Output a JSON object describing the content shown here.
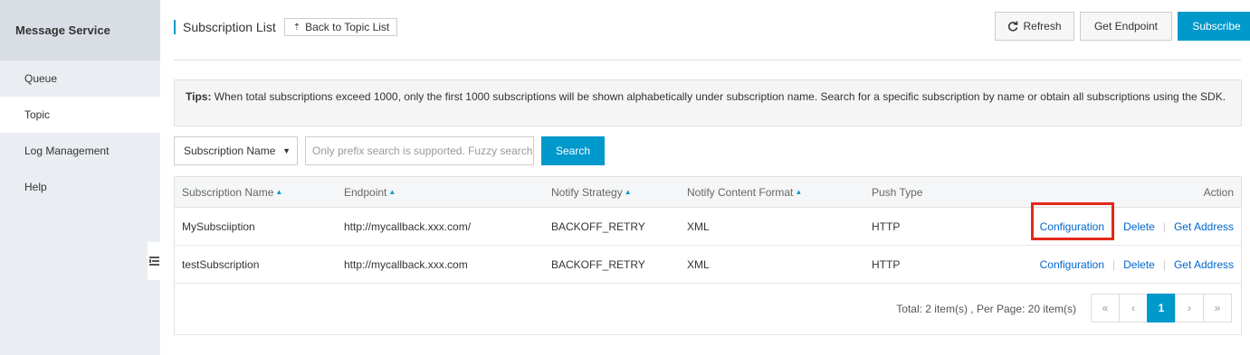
{
  "sidebar": {
    "title": "Message Service",
    "items": [
      {
        "label": "Queue"
      },
      {
        "label": "Topic"
      },
      {
        "label": "Log Management"
      },
      {
        "label": "Help"
      }
    ]
  },
  "header": {
    "title": "Subscription List",
    "back_label": "Back to Topic List",
    "refresh_label": "Refresh",
    "get_endpoint_label": "Get Endpoint",
    "subscribe_label": "Subscribe"
  },
  "tips": {
    "prefix": "Tips:",
    "text": " When total subscriptions exceed 1000, only the first 1000 subscriptions will be shown alphabetically under subscription name. Search for a specific subscription by name or obtain all subscriptions using the SDK."
  },
  "filter": {
    "select_value": "Subscription Name",
    "search_placeholder": "Only prefix search is supported. Fuzzy search is not supported.",
    "search_label": "Search"
  },
  "table": {
    "columns": {
      "name": "Subscription Name",
      "endpoint": "Endpoint",
      "strategy": "Notify Strategy",
      "format": "Notify Content Format",
      "push": "Push Type",
      "action": "Action"
    },
    "rows": [
      {
        "name": "MySubsciiption",
        "endpoint": "http://mycallback.xxx.com/",
        "strategy": "BACKOFF_RETRY",
        "format": "XML",
        "push": "HTTP"
      },
      {
        "name": "testSubscription",
        "endpoint": "http://mycallback.xxx.com",
        "strategy": "BACKOFF_RETRY",
        "format": "XML",
        "push": "HTTP"
      }
    ],
    "actions": {
      "configuration": "Configuration",
      "delete": "Delete",
      "get_address": "Get Address",
      "separator": "|"
    }
  },
  "pagination": {
    "total_text": "Total: 2 item(s) ,  Per Page: 20 item(s)",
    "first": "«",
    "prev": "‹",
    "current": "1",
    "next": "›",
    "last": "»"
  },
  "colors": {
    "accent": "#0099cc",
    "link": "#0066cc",
    "highlight": "#e4281a"
  }
}
